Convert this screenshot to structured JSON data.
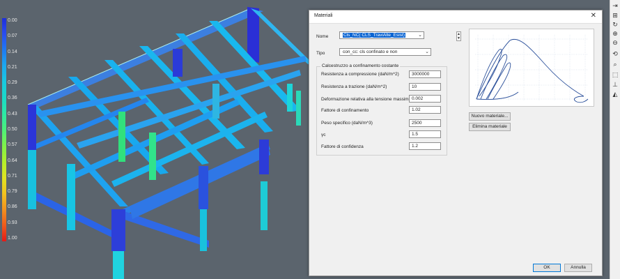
{
  "legend": {
    "labels": [
      "0.00",
      "0.07",
      "0.14",
      "0.21",
      "0.29",
      "0.36",
      "0.43",
      "0.50",
      "0.57",
      "0.64",
      "0.71",
      "0.79",
      "0.86",
      "0.93",
      "1.00"
    ],
    "colors": [
      "#1e2fd9",
      "#2a4df0",
      "#1f7af2",
      "#1ca9f0",
      "#19c9e0",
      "#1ad9c8",
      "#2ce8a5",
      "#4cf07a",
      "#7ff24a",
      "#b2ef2b",
      "#dfe422",
      "#f2c31f",
      "#f2921f",
      "#ee5a1c",
      "#e41a18"
    ]
  },
  "toolbar": {
    "icons": [
      "import-icon",
      "zoom-window-icon",
      "rotate-icon",
      "zoom-in-icon",
      "zoom-out-icon",
      "rotate-view-icon",
      "select-icon",
      "view-3d-icon",
      "axes-icon",
      "shade-icon"
    ]
  },
  "dialog": {
    "title": "Materiali",
    "close_glyph": "✕",
    "nome_label": "Nome",
    "nome_value": "Cls_NC( CLS_TraviAlte_Esist)",
    "tipo_label": "Tipo",
    "tipo_value": "con_cc: cls confinato e non",
    "group_title": "Calcestruzzo a confinamento costante",
    "fields": [
      {
        "label": "Resistenza a compressione (daN/m^2)",
        "value": "3000000"
      },
      {
        "label": "Resistenza a trazione (daN/m^2)",
        "value": "10"
      },
      {
        "label": "Deformazione relativa alla tensione massima",
        "value": "0.002"
      },
      {
        "label": "Fattore di confinamento",
        "value": "1.02"
      },
      {
        "label": "Peso specifico (daN/m^3)",
        "value": "2500"
      },
      {
        "label": "γc",
        "value": "1.5"
      },
      {
        "label": "Fattore di confidenza",
        "value": "1.2"
      }
    ],
    "spin_up": "▲",
    "spin_down": "▼",
    "new_material_label": "Nuovo materiale...",
    "delete_material_label": "Elimina materiale",
    "ok_label": "OK",
    "cancel_label": "Annulla"
  }
}
